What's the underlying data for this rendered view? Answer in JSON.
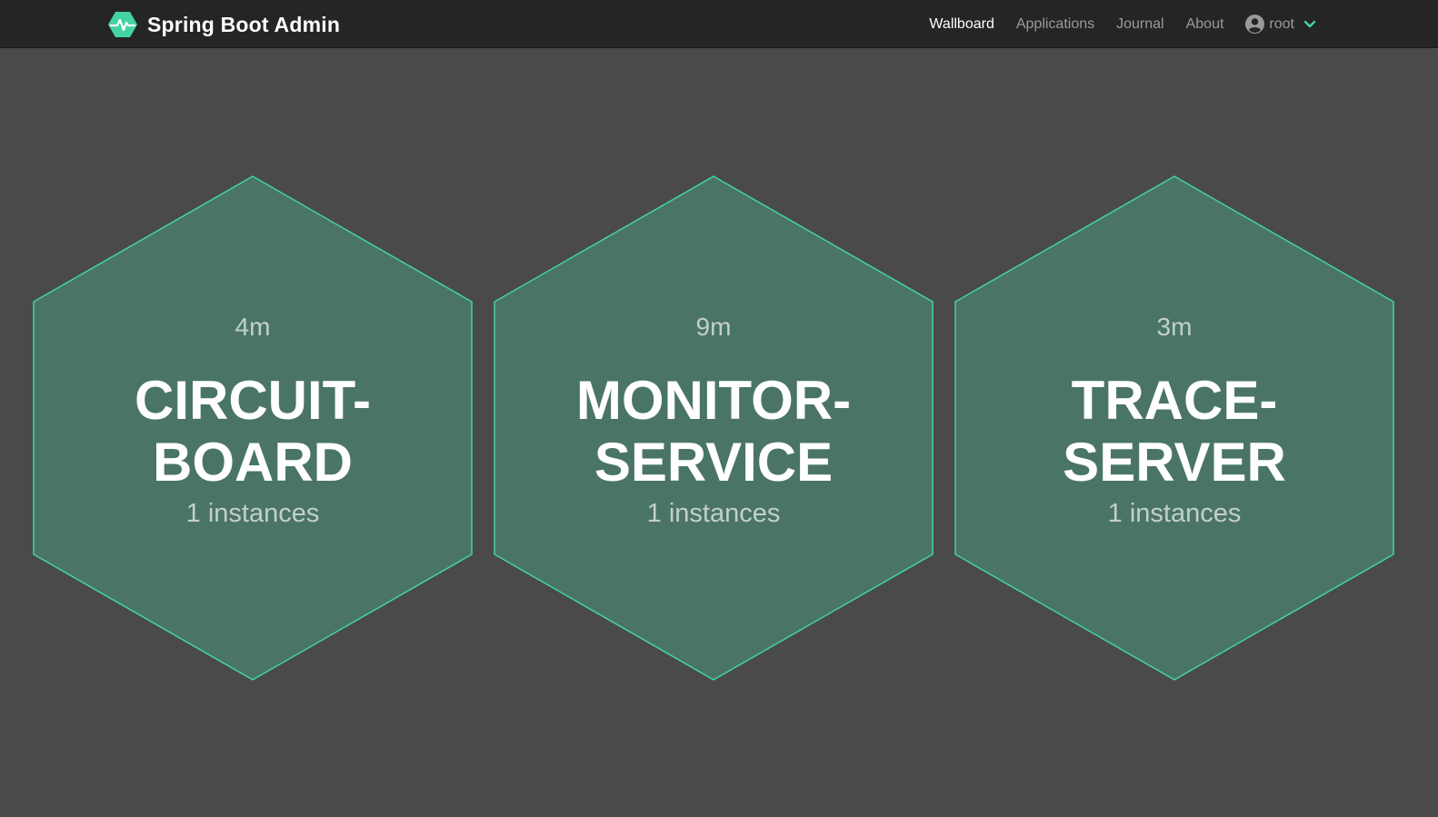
{
  "colors": {
    "navbar_bg": "#252525",
    "page_bg": "#4a4a4a",
    "hex_fill": "#4a7566",
    "hex_stroke": "#42d3a5",
    "brand_accent": "#42d3a5"
  },
  "header": {
    "brand_icon": "heartbeat-hexagon-icon",
    "brand_name": "Spring Boot Admin",
    "nav": {
      "wallboard": "Wallboard",
      "applications": "Applications",
      "journal": "Journal",
      "about": "About"
    },
    "user": {
      "icon": "user-circle-icon",
      "name": "root",
      "dropdown_icon": "chevron-down-icon"
    }
  },
  "wallboard": {
    "applications": [
      {
        "uptime": "4m",
        "name_line1": "CIRCUIT-",
        "name_line2": "BOARD",
        "instances": "1 instances"
      },
      {
        "uptime": "9m",
        "name_line1": "MONITOR-",
        "name_line2": "SERVICE",
        "instances": "1 instances"
      },
      {
        "uptime": "3m",
        "name_line1": "TRACE-",
        "name_line2": "SERVER",
        "instances": "1 instances"
      }
    ]
  }
}
